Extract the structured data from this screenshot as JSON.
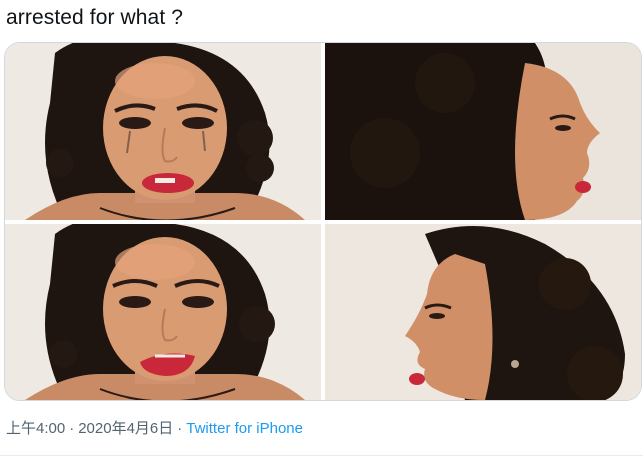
{
  "tweet": {
    "text": "arrested for what ?",
    "time": "上午4:00",
    "date": "2020年4月6日",
    "separator": "·",
    "source": "Twitter for iPhone"
  },
  "media": {
    "photos": [
      {
        "subject": "woman-front-lip-bite-photo"
      },
      {
        "subject": "woman-profile-right-photo"
      },
      {
        "subject": "woman-front-snarl-photo"
      },
      {
        "subject": "woman-profile-left-photo"
      }
    ]
  },
  "colors": {
    "text": "#0f1419",
    "meta": "#536471",
    "link": "#1d9bf0",
    "skin": "#d89a72",
    "hair": "#1e1410",
    "lips": "#c8283a",
    "background": "#efe8e1"
  }
}
